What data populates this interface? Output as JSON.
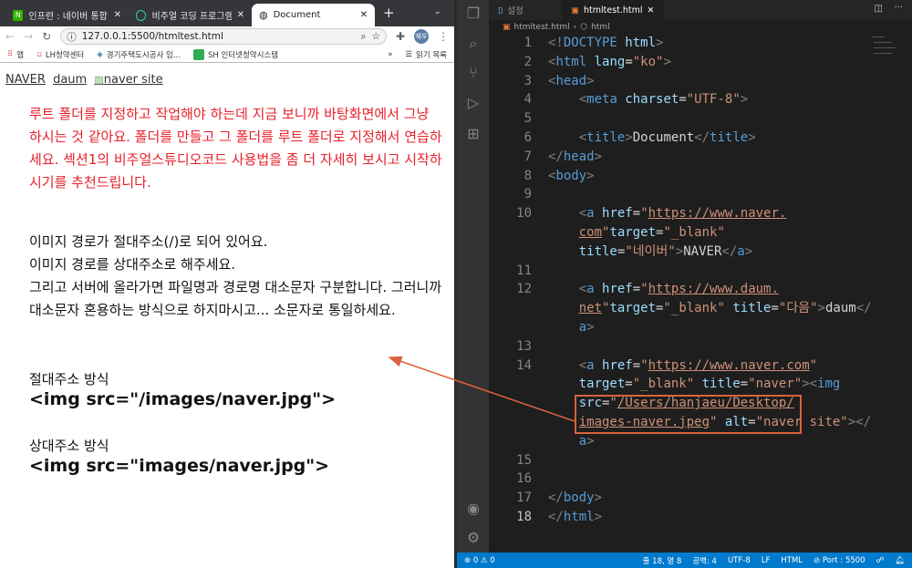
{
  "browser": {
    "tabs": [
      {
        "label": "인프런 : 네이버 통합검색",
        "active": false
      },
      {
        "label": "비주얼 코딩 프로그램에서 ...",
        "active": false
      },
      {
        "label": "Document",
        "active": true
      }
    ],
    "new_tab": "+",
    "url": "127.0.0.1:5500/htmltest.html",
    "avatar": "재우",
    "bookmarks": [
      "앱",
      "LH청약센터",
      "경기주택도시공사 임...",
      "SH 인터넷청약시스템"
    ],
    "more": "»",
    "reading_list": "읽기 목록"
  },
  "page": {
    "links": [
      "NAVER",
      "daum",
      "naver site"
    ],
    "red_text": "루트 폴더를 지정하고 작업해야 하는데 지금 보니까 바탕화면에서 그냥 하시는 것 같아요. 폴더를 만들고 그 폴더를 루트 폴더로 지정해서 연습하세요. 섹션1의 비주얼스튜디오코드 사용법을 좀 더 자세히 보시고 시작하시기를 추천드립니다.",
    "black_lines": [
      "이미지 경로가 절대주소(/)로 되어 있어요.",
      "이미지 경로를 상대주소로 해주세요.",
      "그리고 서버에 올라가면 파일명과 경로명 대소문자 구분합니다. 그러니까 대소문자 혼용하는 방식으로 하지마시고... 소문자로 통일하세요."
    ],
    "absolute_label": "절대주소 방식",
    "absolute_code": "<img src=\"/images/naver.jpg\">",
    "relative_label": "상대주소 방식",
    "relative_code": "<img src=\"images/naver.jpg\">"
  },
  "editor": {
    "tabs": [
      "설정",
      "htmltest.html"
    ],
    "breadcrumb": [
      "htmltest.html",
      "html"
    ],
    "rows": [
      {
        "n": "1",
        "s": [
          [
            "p",
            "<!"
          ],
          [
            "tag",
            "DOCTYPE"
          ],
          [
            "attr",
            " html"
          ],
          [
            "p",
            ">"
          ]
        ]
      },
      {
        "n": "2",
        "s": [
          [
            "p",
            "<"
          ],
          [
            "tag",
            "html"
          ],
          [
            "attr",
            " lang"
          ],
          [
            "txt",
            "="
          ],
          [
            "str",
            "\"ko\""
          ],
          [
            "p",
            ">"
          ]
        ]
      },
      {
        "n": "3",
        "s": [
          [
            "p",
            "<"
          ],
          [
            "tag",
            "head"
          ],
          [
            "p",
            ">"
          ]
        ]
      },
      {
        "n": "4",
        "s": [
          [
            "txt",
            "    "
          ],
          [
            "p",
            "<"
          ],
          [
            "tag",
            "meta"
          ],
          [
            "attr",
            " charset"
          ],
          [
            "txt",
            "="
          ],
          [
            "str",
            "\"UTF-8\""
          ],
          [
            "p",
            ">"
          ]
        ]
      },
      {
        "n": "5",
        "s": []
      },
      {
        "n": "6",
        "s": [
          [
            "txt",
            "    "
          ],
          [
            "p",
            "<"
          ],
          [
            "tag",
            "title"
          ],
          [
            "p",
            ">"
          ],
          [
            "txt",
            "Document"
          ],
          [
            "p",
            "</"
          ],
          [
            "tag",
            "title"
          ],
          [
            "p",
            ">"
          ]
        ]
      },
      {
        "n": "7",
        "s": [
          [
            "p",
            "</"
          ],
          [
            "tag",
            "head"
          ],
          [
            "p",
            ">"
          ]
        ]
      },
      {
        "n": "8",
        "s": [
          [
            "p",
            "<"
          ],
          [
            "tag",
            "body"
          ],
          [
            "p",
            ">"
          ]
        ]
      },
      {
        "n": "9",
        "s": []
      },
      {
        "n": "10",
        "s": [
          [
            "txt",
            "    "
          ],
          [
            "p",
            "<"
          ],
          [
            "tag",
            "a"
          ],
          [
            "attr",
            " href"
          ],
          [
            "txt",
            "="
          ],
          [
            "str",
            "\""
          ],
          [
            "link",
            "https://www.naver."
          ]
        ]
      },
      {
        "n": "",
        "s": [
          [
            "txt",
            "    "
          ],
          [
            "link",
            "com"
          ],
          [
            "str",
            "\""
          ],
          [
            "attr",
            "target"
          ],
          [
            "txt",
            "="
          ],
          [
            "str",
            "\"_blank\""
          ]
        ]
      },
      {
        "n": "",
        "s": [
          [
            "txt",
            "    "
          ],
          [
            "attr",
            "title"
          ],
          [
            "txt",
            "="
          ],
          [
            "str",
            "\"네이버\""
          ],
          [
            "p",
            ">"
          ],
          [
            "txt",
            "NAVER"
          ],
          [
            "p",
            "</"
          ],
          [
            "tag",
            "a"
          ],
          [
            "p",
            ">"
          ]
        ]
      },
      {
        "n": "11",
        "s": []
      },
      {
        "n": "12",
        "s": [
          [
            "txt",
            "    "
          ],
          [
            "p",
            "<"
          ],
          [
            "tag",
            "a"
          ],
          [
            "attr",
            " href"
          ],
          [
            "txt",
            "="
          ],
          [
            "str",
            "\""
          ],
          [
            "link",
            "https://www.daum."
          ]
        ]
      },
      {
        "n": "",
        "s": [
          [
            "txt",
            "    "
          ],
          [
            "link",
            "net"
          ],
          [
            "str",
            "\""
          ],
          [
            "attr",
            "target"
          ],
          [
            "txt",
            "="
          ],
          [
            "str",
            "\"_blank\""
          ],
          [
            "attr",
            " title"
          ],
          [
            "txt",
            "="
          ],
          [
            "str",
            "\"다음\""
          ],
          [
            "p",
            ">"
          ],
          [
            "txt",
            "daum"
          ],
          [
            "p",
            "</"
          ]
        ]
      },
      {
        "n": "",
        "s": [
          [
            "txt",
            "    "
          ],
          [
            "tag",
            "a"
          ],
          [
            "p",
            ">"
          ]
        ]
      },
      {
        "n": "13",
        "s": []
      },
      {
        "n": "14",
        "s": [
          [
            "txt",
            "    "
          ],
          [
            "p",
            "<"
          ],
          [
            "tag",
            "a"
          ],
          [
            "attr",
            " href"
          ],
          [
            "txt",
            "="
          ],
          [
            "str",
            "\""
          ],
          [
            "link",
            "https://www.naver.com"
          ],
          [
            "str",
            "\""
          ]
        ]
      },
      {
        "n": "",
        "s": [
          [
            "txt",
            "    "
          ],
          [
            "attr",
            "target"
          ],
          [
            "txt",
            "="
          ],
          [
            "str",
            "\"_blank\""
          ],
          [
            "attr",
            " title"
          ],
          [
            "txt",
            "="
          ],
          [
            "str",
            "\"naver\""
          ],
          [
            "p",
            "><"
          ],
          [
            "tag",
            "img"
          ]
        ]
      },
      {
        "n": "",
        "s": [
          [
            "txt",
            "    "
          ],
          [
            "attr",
            "src"
          ],
          [
            "txt",
            "="
          ],
          [
            "str",
            "\""
          ],
          [
            "link",
            "/Users/hanjaeu/Desktop/"
          ]
        ]
      },
      {
        "n": "",
        "s": [
          [
            "txt",
            "    "
          ],
          [
            "link",
            "images-naver.jpeg"
          ],
          [
            "str",
            "\""
          ],
          [
            "attr",
            " alt"
          ],
          [
            "txt",
            "="
          ],
          [
            "str",
            "\"naver site\""
          ],
          [
            "p",
            "></"
          ]
        ]
      },
      {
        "n": "",
        "s": [
          [
            "txt",
            "    "
          ],
          [
            "tag",
            "a"
          ],
          [
            "p",
            ">"
          ]
        ]
      },
      {
        "n": "15",
        "s": []
      },
      {
        "n": "16",
        "s": []
      },
      {
        "n": "17",
        "s": [
          [
            "p",
            "</"
          ],
          [
            "tag",
            "body"
          ],
          [
            "p",
            ">"
          ]
        ]
      },
      {
        "n": "18",
        "s": [
          [
            "p",
            "</"
          ],
          [
            "tag",
            "html"
          ],
          [
            "p",
            ">"
          ]
        ],
        "cur": true
      }
    ]
  },
  "status": {
    "problems": "⊗ 0 ⚠ 0",
    "position": "줄 18, 열 8",
    "spaces": "공백: 4",
    "encoding": "UTF-8",
    "eol": "LF",
    "language": "HTML",
    "port": "⊘ Port : 5500"
  },
  "colors": {
    "accent": "#007acc",
    "annotation": "#d9623b",
    "red_text": "#e8202a"
  }
}
